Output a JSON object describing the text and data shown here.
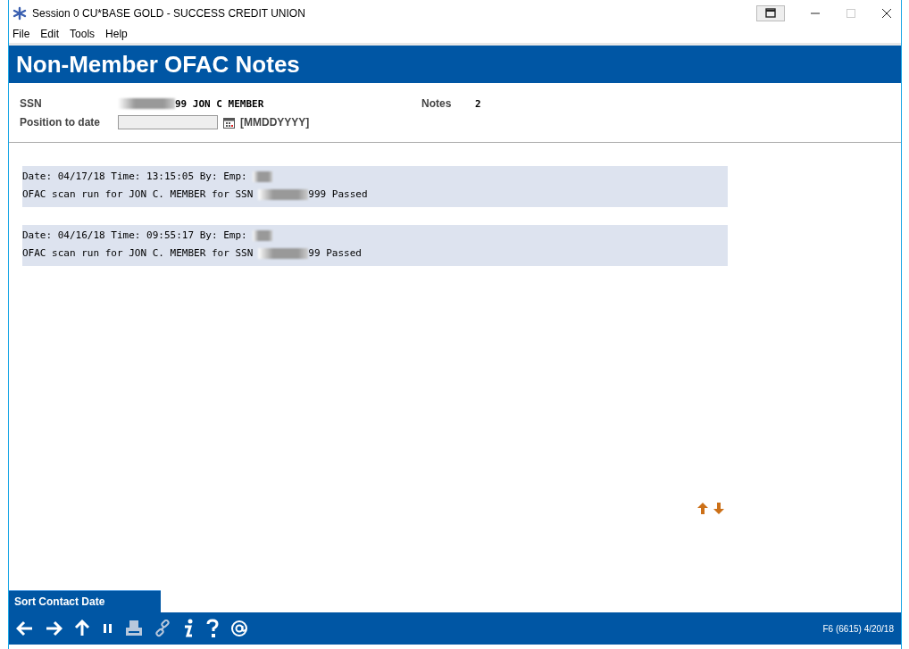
{
  "window": {
    "title": "Session 0 CU*BASE GOLD - SUCCESS CREDIT UNION"
  },
  "menu": [
    "File",
    "Edit",
    "Tools",
    "Help"
  ],
  "header": {
    "title": "Non-Member OFAC Notes"
  },
  "member": {
    "ssn_label": "SSN",
    "ssn_tail": "99 JON C MEMBER",
    "notes_label": "Notes",
    "notes_count": "2"
  },
  "position": {
    "label": "Position to date",
    "format": "[MMDDYYYY]"
  },
  "notes": [
    {
      "head": "Date: 04/17/18 Time: 13:15:05 By: Emp:",
      "body": "OFAC scan run for JON C. MEMBER for SSN",
      "body_tail": "999 Passed"
    },
    {
      "head": "Date: 04/16/18 Time: 09:55:17 By: Emp:",
      "body": "OFAC scan run for JON C. MEMBER for SSN",
      "body_tail": "99 Passed"
    }
  ],
  "sort_tab": {
    "label": "Sort Contact Date"
  },
  "status": "F6 (6615) 4/20/18"
}
